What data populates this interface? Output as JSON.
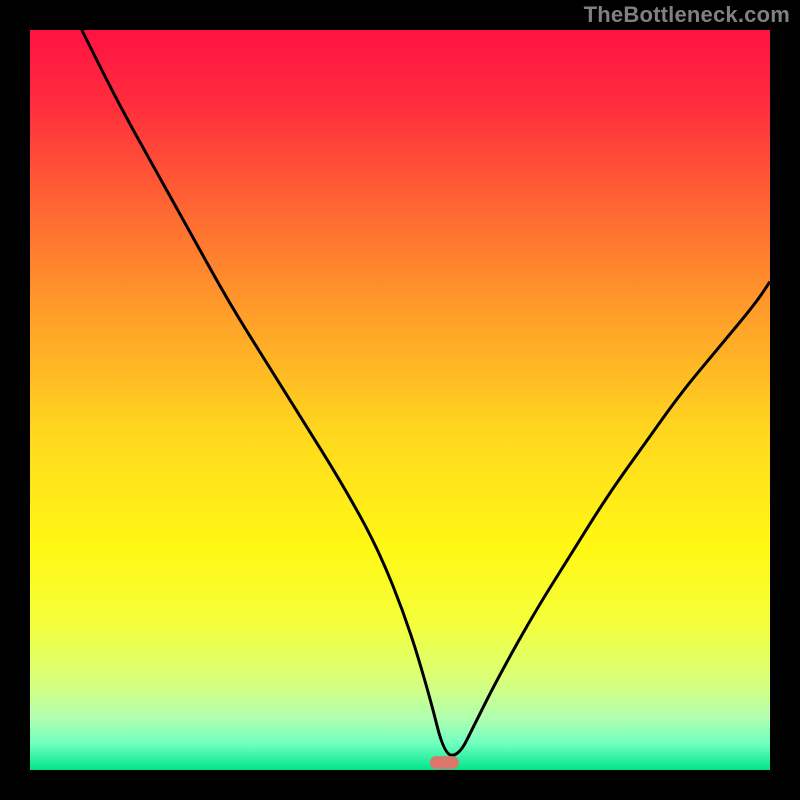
{
  "watermark": {
    "text": "TheBottleneck.com"
  },
  "colors": {
    "frame": "#000000",
    "curve": "#000000",
    "marker_fill": "#d9776d",
    "marker_stroke": "#d9776d",
    "gradient_stops": [
      {
        "offset": 0.0,
        "color": "#ff1242"
      },
      {
        "offset": 0.1,
        "color": "#ff2d3d"
      },
      {
        "offset": 0.25,
        "color": "#ff6a32"
      },
      {
        "offset": 0.4,
        "color": "#ffa428"
      },
      {
        "offset": 0.55,
        "color": "#ffd91e"
      },
      {
        "offset": 0.7,
        "color": "#fff814"
      },
      {
        "offset": 0.8,
        "color": "#f4ff3a"
      },
      {
        "offset": 0.88,
        "color": "#d8ff7a"
      },
      {
        "offset": 0.93,
        "color": "#b0ffb0"
      },
      {
        "offset": 0.965,
        "color": "#6fffc0"
      },
      {
        "offset": 1.0,
        "color": "#00e58a"
      }
    ]
  },
  "chart_data": {
    "type": "line",
    "title": "",
    "xlabel": "",
    "ylabel": "",
    "xlim": [
      0,
      100
    ],
    "ylim": [
      0,
      100
    ],
    "categories_note": "axes unlabeled; values are relative positions read from the plot area",
    "marker": {
      "x": 56,
      "y": 1
    },
    "series": [
      {
        "name": "bottleneck-curve",
        "x": [
          7,
          12,
          17,
          22,
          27,
          32,
          37,
          42,
          47,
          51,
          54,
          56,
          58,
          60,
          63,
          68,
          73,
          78,
          83,
          88,
          93,
          98,
          100
        ],
        "y": [
          100,
          90,
          81,
          72,
          63,
          55,
          47,
          39,
          30,
          20,
          10,
          2,
          2,
          6,
          12,
          21,
          29,
          37,
          44,
          51,
          57,
          63,
          66
        ]
      }
    ]
  }
}
